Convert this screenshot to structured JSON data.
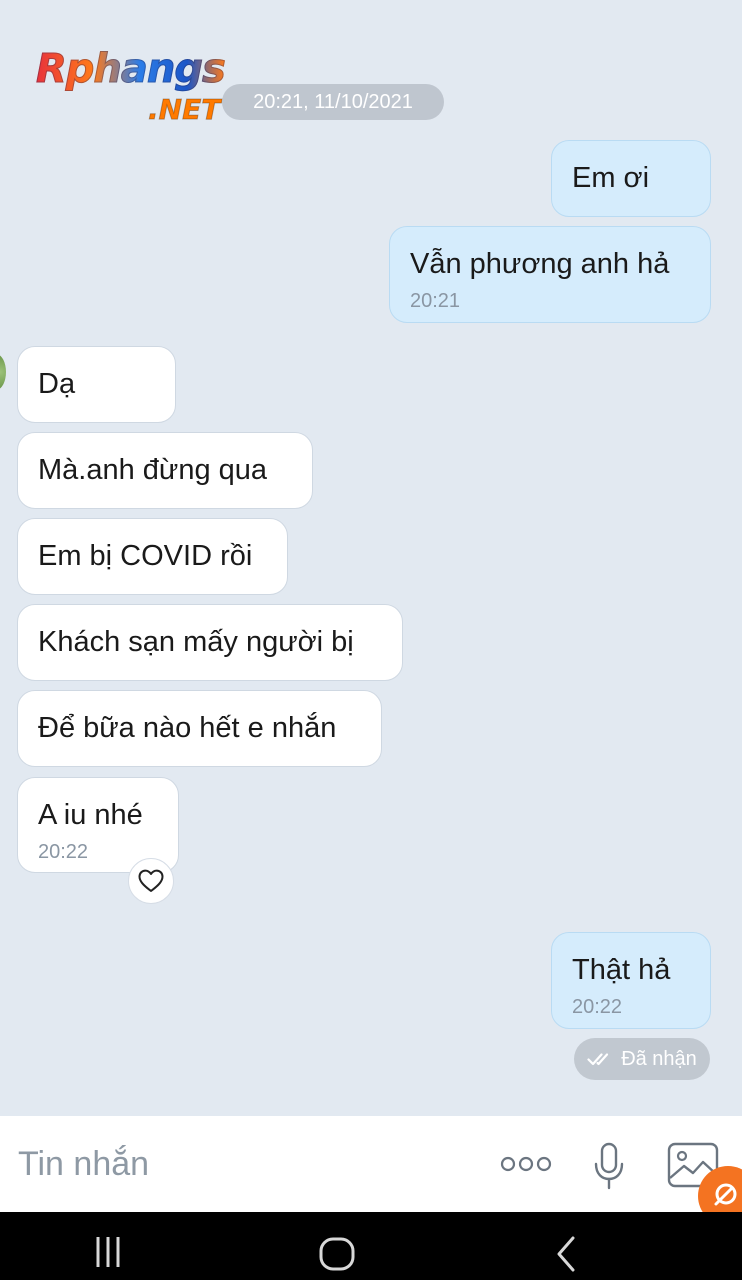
{
  "watermark": {
    "top": "Rphangs",
    "bottom": ".NET"
  },
  "date_separator": "20:21, 11/10/2021",
  "messages": [
    {
      "direction": "out",
      "text": "Em ơi",
      "time": ""
    },
    {
      "direction": "out",
      "text": "Vẫn phương anh hả",
      "time": "20:21"
    },
    {
      "direction": "in",
      "text": "Dạ",
      "time": ""
    },
    {
      "direction": "in",
      "text": "Mà.anh đừng qua",
      "time": ""
    },
    {
      "direction": "in",
      "text": "Em bị COVID rồi",
      "time": ""
    },
    {
      "direction": "in",
      "text": "Khách sạn mấy người bị",
      "time": ""
    },
    {
      "direction": "in",
      "text": "Để bữa nào hết e nhắn",
      "time": ""
    },
    {
      "direction": "in",
      "text": "A iu nhé",
      "time": "20:22"
    },
    {
      "direction": "out",
      "text": "Thật hả",
      "time": "20:22"
    }
  ],
  "delivery_status": "Đã nhận",
  "composer": {
    "placeholder": "Tin nhắn"
  },
  "icons": {
    "reaction": "heart-icon",
    "more": "more-dots-icon",
    "mic": "microphone-icon",
    "image": "image-icon",
    "status": "double-check-icon"
  },
  "colors": {
    "background": "#e2e9f1",
    "bubble_out": "#d5ecfc",
    "bubble_in": "#ffffff",
    "accent_badge": "#f47321"
  }
}
